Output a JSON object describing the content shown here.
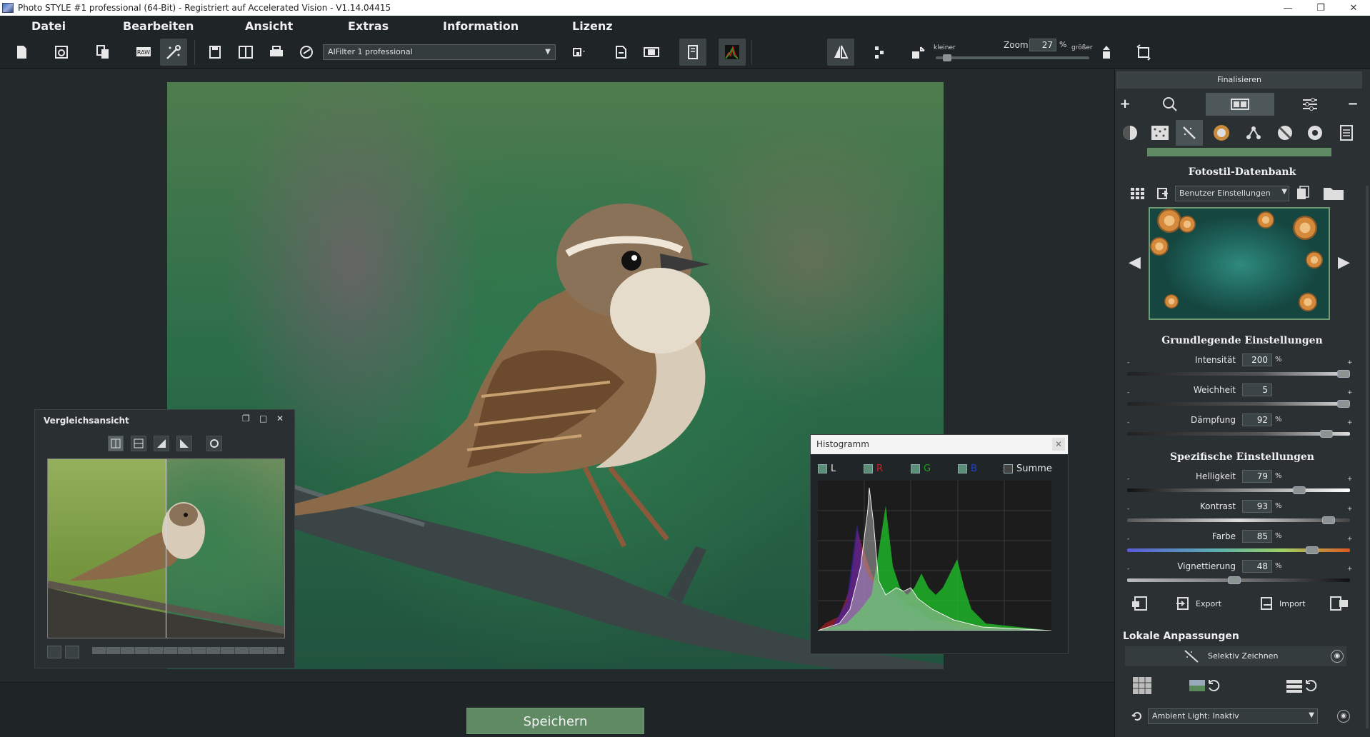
{
  "window": {
    "title": "Photo STYLE #1 professional (64-Bit) - Registriert auf Accelerated Vision - V1.14.04415",
    "controls": [
      "—",
      "❐",
      "✕"
    ]
  },
  "menu": [
    "Datei",
    "Bearbeiten",
    "Ansicht",
    "Extras",
    "Information",
    "Lizenz"
  ],
  "toolbar": {
    "filter_select": "AIFilter 1 professional",
    "zoom": {
      "smaller_label": "kleiner",
      "label": "Zoom",
      "value": "27",
      "unit": "%",
      "larger_label": "größer",
      "level": 0.05
    }
  },
  "comparison": {
    "title": "Vergleichsansicht",
    "split_position": 0.5
  },
  "histogram": {
    "title": "Histogramm",
    "channels": [
      {
        "label": "L",
        "color": "#e6e6e6",
        "checked": true
      },
      {
        "label": "R",
        "color": "#d02020",
        "checked": true
      },
      {
        "label": "G",
        "color": "#20a020",
        "checked": true
      },
      {
        "label": "B",
        "color": "#2040d0",
        "checked": true
      }
    ],
    "sum_label": "Summe",
    "sum_checked": false
  },
  "bottom": {
    "save_label": "Speichern"
  },
  "panel": {
    "finalize_label": "Finalisieren",
    "database": {
      "title": "Fotostil-Datenbank",
      "select": "Benutzer Einstellungen"
    },
    "basic": {
      "title": "Grundlegende Einstellungen",
      "sliders": [
        {
          "label": "Intensität",
          "value": "200",
          "unit": "%",
          "level": 1.0
        },
        {
          "label": "Weichheit",
          "value": "5",
          "unit": "",
          "level": 1.0
        },
        {
          "label": "Dämpfung",
          "value": "92",
          "unit": "%",
          "level": 0.92
        }
      ]
    },
    "specific": {
      "title": "Spezifische Einstellungen",
      "sliders": [
        {
          "label": "Helligkeit",
          "value": "79",
          "unit": "%",
          "level": 0.79
        },
        {
          "label": "Kontrast",
          "value": "93",
          "unit": "%",
          "level": 0.93
        },
        {
          "label": "Farbe",
          "value": "85",
          "unit": "%",
          "level": 0.85
        },
        {
          "label": "Vignettierung",
          "value": "48",
          "unit": "%",
          "level": 0.48
        }
      ]
    },
    "export_label": "Export",
    "import_label": "Import",
    "local": {
      "title": "Lokale Anpassungen",
      "selective_label": "Selektiv Zeichnen",
      "ambient_select": "Ambient Light: Inaktiv"
    },
    "slider_minus": "-",
    "slider_plus": "+"
  }
}
